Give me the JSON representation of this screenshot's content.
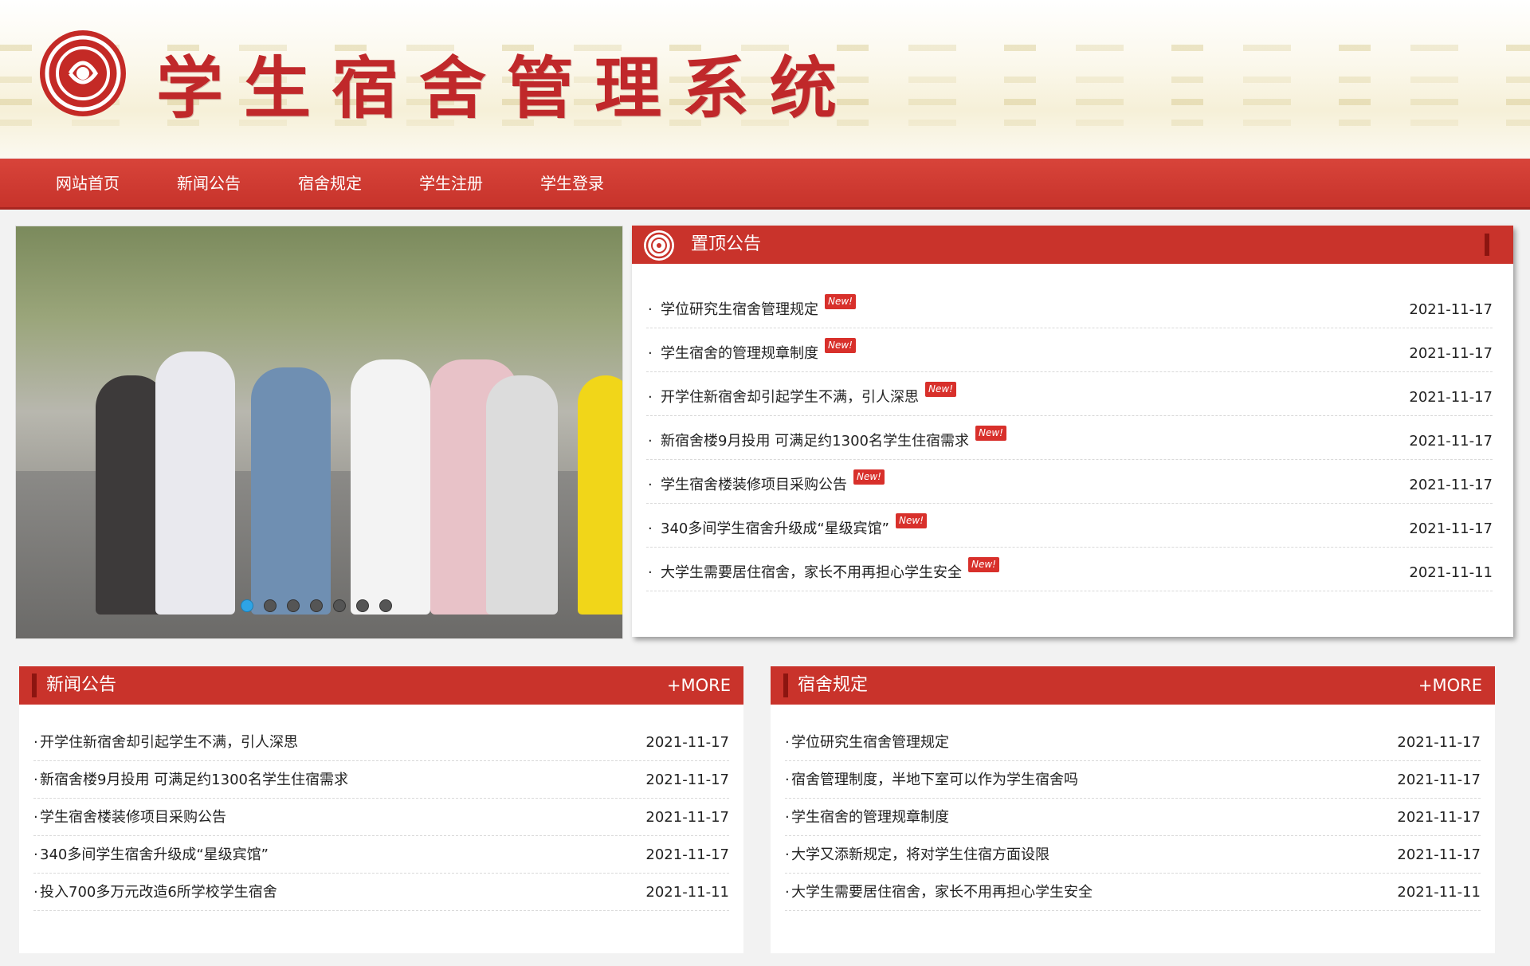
{
  "site": {
    "title": "学生宿舍管理系统"
  },
  "nav": [
    "网站首页",
    "新闻公告",
    "宿舍规定",
    "学生注册",
    "学生登录"
  ],
  "slider": {
    "dots": 7,
    "active_index": 0
  },
  "pinned": {
    "title": "置顶公告",
    "badge": "New!",
    "items": [
      {
        "title": "学位研究生宿舍管理规定",
        "date": "2021-11-17"
      },
      {
        "title": "学生宿舍的管理规章制度",
        "date": "2021-11-17"
      },
      {
        "title": "开学住新宿舍却引起学生不满，引人深思",
        "date": "2021-11-17"
      },
      {
        "title": "新宿舍楼9月投用 可满足约1300名学生住宿需求",
        "date": "2021-11-17"
      },
      {
        "title": "学生宿舍楼装修项目采购公告",
        "date": "2021-11-17"
      },
      {
        "title": "340多间学生宿舍升级成“星级宾馆”",
        "date": "2021-11-17"
      },
      {
        "title": "大学生需要居住宿舍，家长不用再担心学生安全",
        "date": "2021-11-11"
      }
    ]
  },
  "news": {
    "title": "新闻公告",
    "more": "+MORE",
    "items": [
      {
        "title": "开学住新宿舍却引起学生不满，引人深思",
        "date": "2021-11-17"
      },
      {
        "title": "新宿舍楼9月投用 可满足约1300名学生住宿需求",
        "date": "2021-11-17"
      },
      {
        "title": "学生宿舍楼装修项目采购公告",
        "date": "2021-11-17"
      },
      {
        "title": "340多间学生宿舍升级成“星级宾馆”",
        "date": "2021-11-17"
      },
      {
        "title": "投入700多万元改造6所学校学生宿舍",
        "date": "2021-11-11"
      }
    ]
  },
  "rules": {
    "title": "宿舍规定",
    "more": "+MORE",
    "items": [
      {
        "title": "学位研究生宿舍管理规定",
        "date": "2021-11-17"
      },
      {
        "title": "宿舍管理制度，半地下室可以作为学生宿舍吗",
        "date": "2021-11-17"
      },
      {
        "title": "学生宿舍的管理规章制度",
        "date": "2021-11-17"
      },
      {
        "title": "大学又添新规定，将对学生住宿方面设限",
        "date": "2021-11-17"
      },
      {
        "title": "大学生需要居住宿舍，家长不用再担心学生安全",
        "date": "2021-11-11"
      }
    ]
  },
  "colors": {
    "primary": "#c9332b",
    "dark": "#8c1510",
    "badge": "#d8302b",
    "dot_active": "#2ea4e6"
  }
}
